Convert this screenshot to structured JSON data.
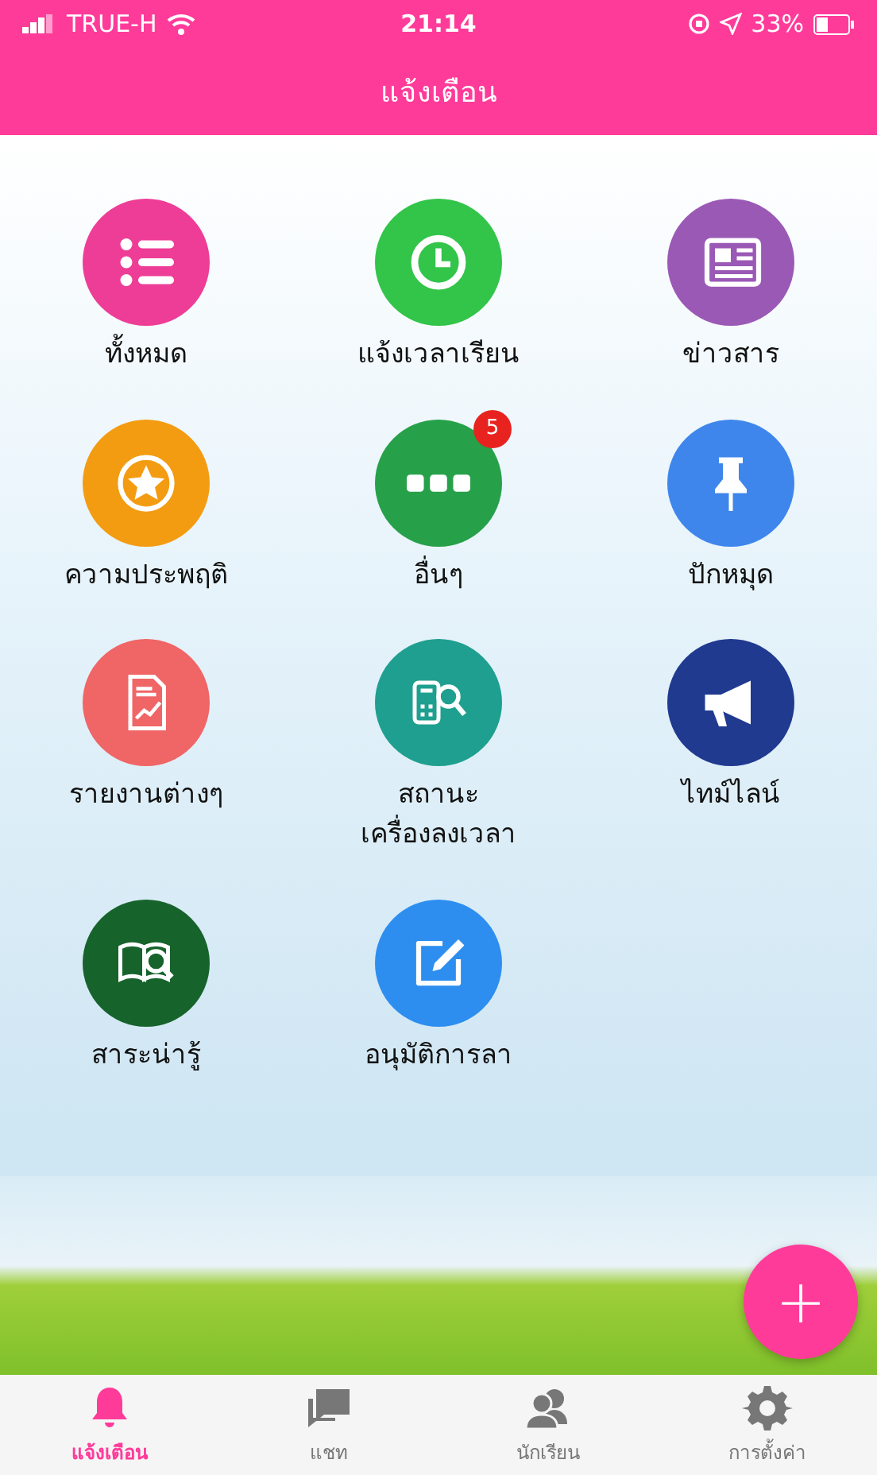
{
  "status_bar": {
    "carrier": "TRUE-H",
    "time": "21:14",
    "battery": "33%"
  },
  "header": {
    "title": "แจ้งเตือน"
  },
  "menu": [
    {
      "label": "ทั้งหมด",
      "color": "#ee3d96"
    },
    {
      "label": "แจ้งเวลาเรียน",
      "color": "#33c44a"
    },
    {
      "label": "ข่าวสาร",
      "color": "#9b59b6"
    },
    {
      "label": "ความประพฤติ",
      "color": "#f39c12"
    },
    {
      "label": "อื่นๆ",
      "color": "#27a04a",
      "badge": "5"
    },
    {
      "label": "ปักหมุด",
      "color": "#3f86ec"
    },
    {
      "label": "รายงานต่างๆ",
      "color": "#f06566"
    },
    {
      "label": "สถานะ\nเครื่องลงเวลา",
      "color": "#1f9f8f"
    },
    {
      "label": "ไทม์ไลน์",
      "color": "#1f3a8f"
    },
    {
      "label": "สาระน่ารู้",
      "color": "#16632b"
    },
    {
      "label": "อนุมัติการลา",
      "color": "#2d8ef0"
    }
  ],
  "fab": {
    "label": "+"
  },
  "tabs": [
    {
      "label": "แจ้งเตือน",
      "selected": true
    },
    {
      "label": "แชท",
      "selected": false
    },
    {
      "label": "นักเรียน",
      "selected": false
    },
    {
      "label": "การตั้งค่า",
      "selected": false
    }
  ]
}
